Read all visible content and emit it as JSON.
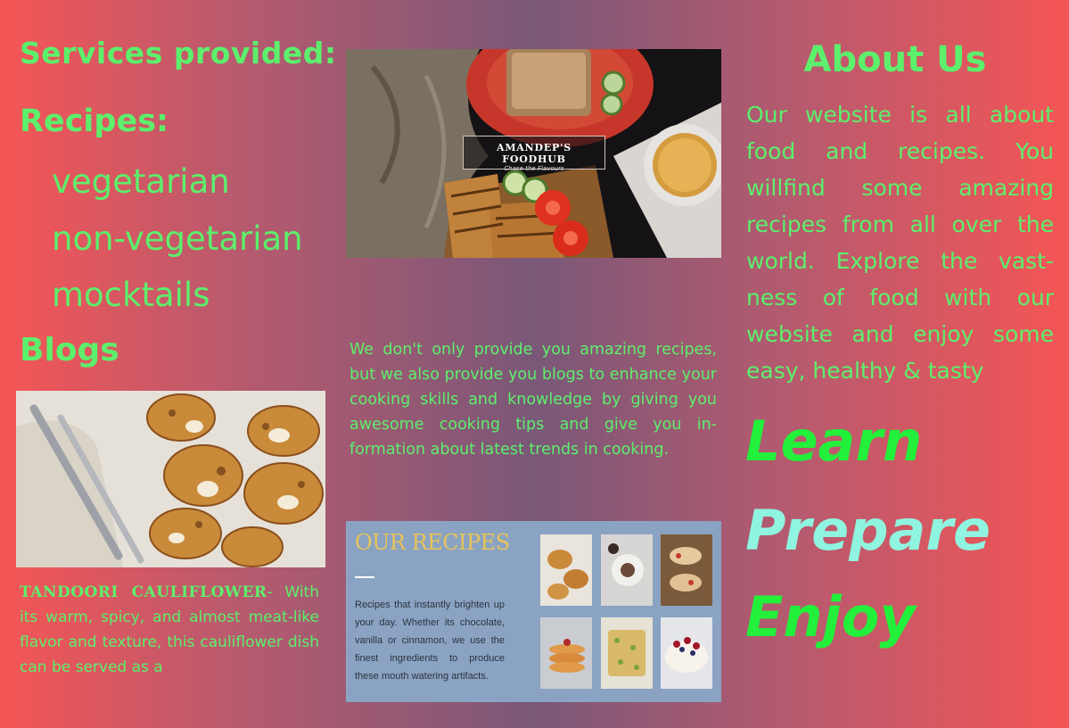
{
  "left": {
    "services_title": "Services provided:",
    "recipes_title": "Recipes:",
    "recipe_items": [
      "vegetarian",
      "non-vegetarian",
      "mocktails"
    ],
    "blogs_title": "Blogs",
    "blog_post": {
      "name": "TANDOORI CAULIFLOWER",
      "separator": "-",
      "text": "With its warm, spicy, and almost meat-like flavor and texture, this cauliflower dish can be served as a"
    }
  },
  "middle": {
    "hero_logo_title": "AMANDEP'S FOODHUB",
    "hero_logo_tagline": "Chase the Flavours",
    "blog_description": "We don't only provide you amazing recipes, but we also provide you blogs to enhance your cooking skills and knowledge by giving you awesome cooking tips and give you in-formation about latest trends in cooking.",
    "banner": {
      "title": "OUR RECIPES",
      "description": "Recipes that instantly brighten up your day. Whether its chocolate, vanilla or cinnamon, we use the finest ingredients to produce these mouth watering artifacts."
    }
  },
  "right": {
    "about_title": "About Us",
    "about_text": "Our website is all about food and recipes. You willfind some amazing recipes from all over the world. Explore the vast-ness of food with our website and enjoy some easy, healthy & tasty",
    "words": [
      "Learn",
      "Prepare",
      "Enjoy"
    ]
  },
  "colors": {
    "text_green": "#5cf06c",
    "bright_green": "#22f03a",
    "aqua": "#8ff5e0",
    "banner_gold": "#e9c35a"
  }
}
